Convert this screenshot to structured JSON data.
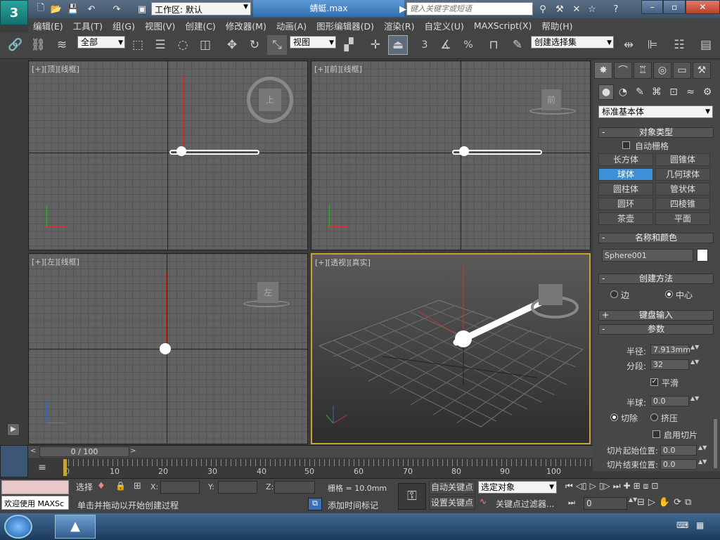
{
  "title": {
    "workspace": "工作区: 默认",
    "doc": "蜻蜓.max",
    "search_placeholder": "键入关键字或短语",
    "logo": "3"
  },
  "menu": [
    "编辑(E)",
    "工具(T)",
    "组(G)",
    "视图(V)",
    "创建(C)",
    "修改器(M)",
    "动画(A)",
    "图形编辑器(D)",
    "渲染(R)",
    "自定义(U)",
    "MAXScript(X)",
    "帮助(H)"
  ],
  "toolbar": {
    "filter": "全部",
    "refcoord": "视图",
    "named_sel": "创建选择集",
    "snap3": "3",
    "pct": "%"
  },
  "viewports": {
    "top": "[+][顶][线框]",
    "front": "[+][前][线框]",
    "left": "[+][左][线框]",
    "persp": "[+][透视][真实]",
    "cube_top": "上",
    "cube_front": "前",
    "cube_left": "左"
  },
  "cmdpanel": {
    "category": "标准基本体",
    "obj_type": "对象类型",
    "autogrid": "自动栅格",
    "objects": [
      "长方体",
      "圆锥体",
      "球体",
      "几何球体",
      "圆柱体",
      "管状体",
      "圆环",
      "四棱锥",
      "茶壶",
      "平面"
    ],
    "active_object": "球体",
    "name_color": "名称和颜色",
    "name": "Sphere001",
    "creation_method": "创建方法",
    "cm_edge": "边",
    "cm_center": "中心",
    "keyboard": "键盘输入",
    "params": "参数",
    "radius_label": "半径:",
    "radius": "7.913mm",
    "segments_label": "分段:",
    "segments": "32",
    "smooth": "平滑",
    "hemisphere_label": "半球:",
    "hemisphere": "0.0",
    "chop": "切除",
    "squash": "挤压",
    "slice_on": "启用切片",
    "slice_from_label": "切片起始位置:",
    "slice_from": "0.0",
    "slice_to_label": "切片结束位置:",
    "slice_to": "0.0"
  },
  "timeline": {
    "frame": "0 / 100",
    "ticks": [
      "0",
      "10",
      "20",
      "30",
      "40",
      "50",
      "60",
      "70",
      "80",
      "90",
      "100"
    ]
  },
  "status": {
    "maxscript": "欢迎使用 MAXSc",
    "sel_label": "选择",
    "x": "X:",
    "y": "Y:",
    "z": "Z:",
    "grid": "栅格 = 10.0mm",
    "prompt": "单击并拖动以开始创建过程",
    "add_time_tag": "添加时间标记",
    "auto_key": "自动关键点",
    "set_key": "设置关键点",
    "sel_obj": "选定对象",
    "key_filters": "关键点过滤器...",
    "frame_field": "0"
  },
  "colors": {
    "accent": "#3d8fd6",
    "active_border": "#c9a23a",
    "axis_red": "#c0392b"
  }
}
